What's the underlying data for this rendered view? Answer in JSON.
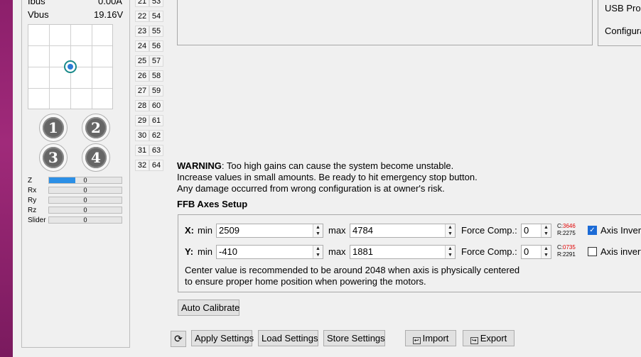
{
  "left_panel": {
    "ibus_label": "Ibus",
    "ibus_value": "0.00A",
    "vbus_label": "Vbus",
    "vbus_value": "19.16V",
    "buttons": [
      "1",
      "2",
      "3",
      "4"
    ],
    "axes": [
      {
        "label": "Z",
        "value": "0",
        "level": 0.36
      },
      {
        "label": "Rx",
        "value": "0",
        "level": 0
      },
      {
        "label": "Ry",
        "value": "0",
        "level": 0
      },
      {
        "label": "Rz",
        "value": "0",
        "level": 0
      },
      {
        "label": "Slider",
        "value": "0",
        "level": 0
      }
    ]
  },
  "button_grid": {
    "col1": [
      "21",
      "22",
      "23",
      "24",
      "25",
      "26",
      "27",
      "28",
      "29",
      "30",
      "31",
      "32"
    ],
    "col2": [
      "53",
      "54",
      "55",
      "56",
      "57",
      "58",
      "59",
      "60",
      "61",
      "62",
      "63",
      "64"
    ]
  },
  "right_menu": [
    "USB Prod",
    "Configura"
  ],
  "warning": {
    "bold": "WARNING",
    "line1": ": Too high gains can cause the system become unstable.",
    "line2": "Increase values in small amounts. Be ready to hit emergency stop button.",
    "line3": "Any damage occurred from wrong configuration is at owner's risk."
  },
  "ffb": {
    "title": "FFB Axes Setup",
    "x": {
      "axis": "X:",
      "min_label": "min",
      "min": "2509",
      "max_label": "max",
      "max": "4784",
      "force_label": "Force Comp.:",
      "force": "0",
      "c_label": "C:",
      "c_value": "3646",
      "r_label": "R:",
      "r_value": "2275",
      "invert_label": "Axis Invert",
      "invert_checked": true
    },
    "y": {
      "axis": "Y:",
      "min_label": "min",
      "min": "-410",
      "max_label": "max",
      "max": "1881",
      "force_label": "Force Comp.:",
      "force": "0",
      "c_label": "C:",
      "c_value": "0735",
      "r_label": "R:",
      "r_value": "2291",
      "invert_label": "Axis invert",
      "invert_checked": false
    },
    "note1": "Center value is recommended to be around 2048 when axis is physically centered",
    "note2": "to ensure proper home position when powering the motors."
  },
  "buttons": {
    "auto_calibrate": "Auto Calibrate",
    "refresh": "⟳",
    "apply": "Apply Settings",
    "load": "Load Settings",
    "store": "Store Settings",
    "import": "Import",
    "export": "Export"
  }
}
